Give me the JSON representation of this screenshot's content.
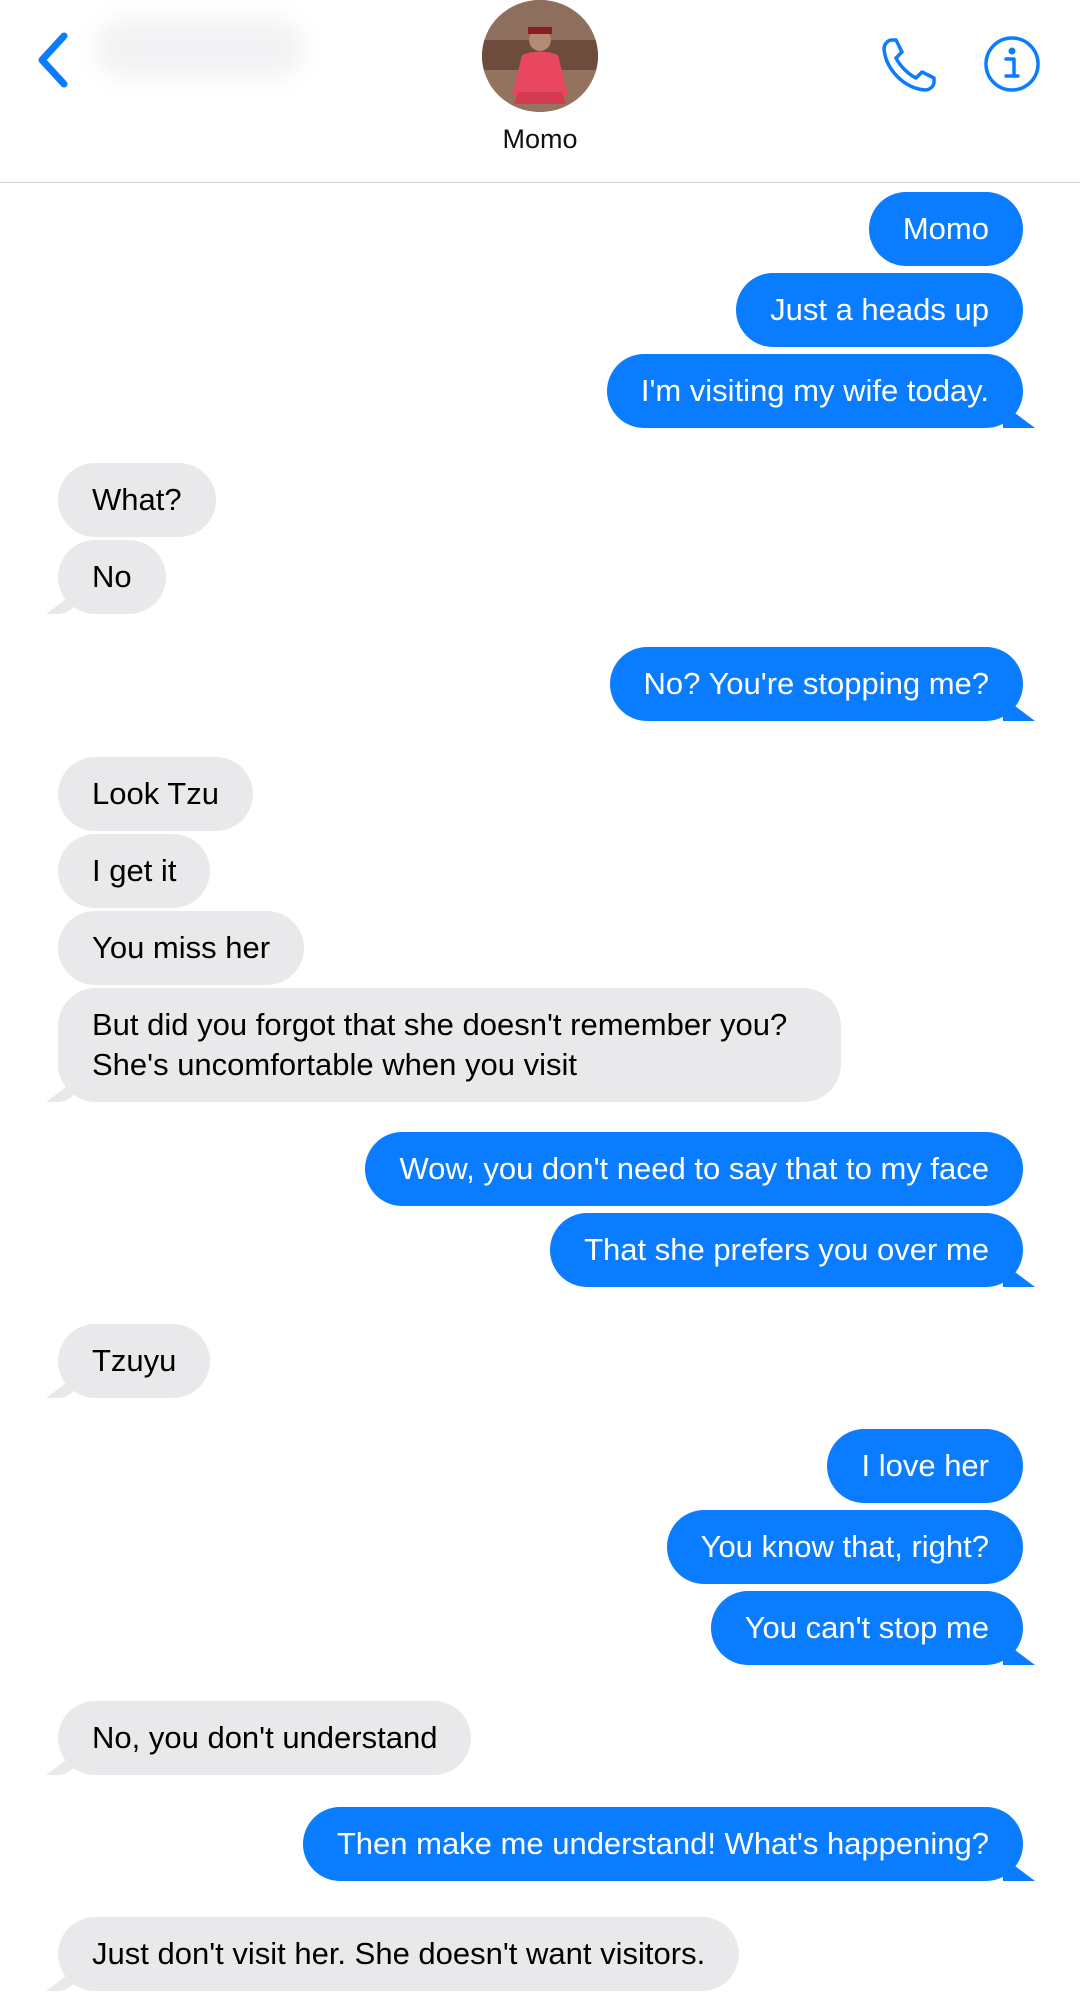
{
  "header": {
    "contact_name": "Momo",
    "back_icon": "chevron-left-icon",
    "call_icon": "phone-icon",
    "info_icon": "info-icon",
    "accent_color": "#0a7cff"
  },
  "messages": [
    {
      "from": "me",
      "text": "Momo"
    },
    {
      "from": "me",
      "text": "Just a heads up"
    },
    {
      "from": "me",
      "text": "I'm visiting my wife today."
    },
    {
      "from": "them",
      "text": "What?"
    },
    {
      "from": "them",
      "text": "No"
    },
    {
      "from": "me",
      "text": "No? You're stopping me?"
    },
    {
      "from": "them",
      "text": "Look Tzu"
    },
    {
      "from": "them",
      "text": "I get it"
    },
    {
      "from": "them",
      "text": "You miss her"
    },
    {
      "from": "them",
      "text": "But did you forgot that she doesn't remember you? She's uncomfortable when you visit"
    },
    {
      "from": "me",
      "text": "Wow, you don't need to say that to my face"
    },
    {
      "from": "me",
      "text": "That she prefers you over me"
    },
    {
      "from": "them",
      "text": "Tzuyu"
    },
    {
      "from": "me",
      "text": "I love her"
    },
    {
      "from": "me",
      "text": "You know that, right?"
    },
    {
      "from": "me",
      "text": "You can't stop me"
    },
    {
      "from": "them",
      "text": "No, you don't understand"
    },
    {
      "from": "me",
      "text": "Then make me understand! What's happening?"
    },
    {
      "from": "them",
      "text": "Just don't visit her. She doesn't want visitors."
    }
  ]
}
